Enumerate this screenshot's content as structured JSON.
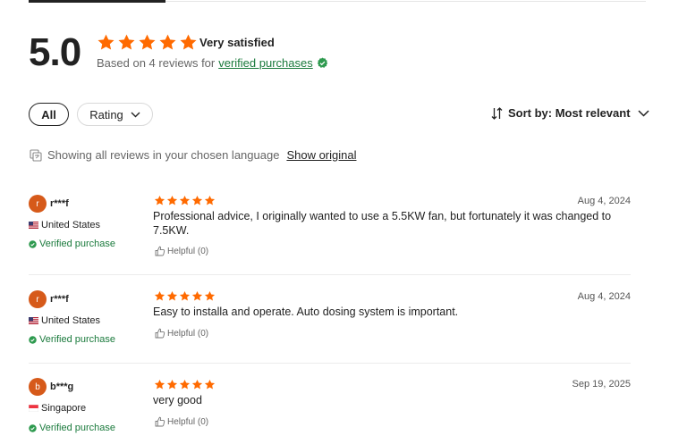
{
  "summary": {
    "rating": "5.0",
    "stars": 5,
    "satisfaction": "Very satisfied",
    "based_on": "Based on 4 reviews for",
    "verified_link": "verified purchases"
  },
  "filters": {
    "all_label": "All",
    "rating_label": "Rating",
    "sort_label": "Sort by: Most relevant"
  },
  "language": {
    "notice": "Showing all reviews in your chosen language",
    "show_original": "Show original"
  },
  "reviews": [
    {
      "initial": "r",
      "user": "r***f",
      "country": "United States",
      "verified": "Verified purchase",
      "stars": 5,
      "date": "Aug 4, 2024",
      "text": "Professional advice, I originally wanted to use a 5.5KW fan, but fortunately it was changed to 7.5KW.",
      "helpful": "Helpful (0)"
    },
    {
      "initial": "r",
      "user": "r***f",
      "country": "United States",
      "verified": "Verified purchase",
      "stars": 5,
      "date": "Aug 4, 2024",
      "text": "Easy to installa and operate. Auto dosing system is important.",
      "helpful": "Helpful (0)"
    },
    {
      "initial": "b",
      "user": "b***g",
      "country": "Singapore",
      "verified": "Verified purchase",
      "stars": 5,
      "date": "Sep 19, 2025",
      "text": "very good",
      "helpful": "Helpful (0)"
    }
  ],
  "colors": {
    "star": "#ff6a00",
    "verified": "#1a7a3c",
    "avatar": "#d65a1a"
  },
  "icons": {
    "star": "star-icon",
    "verified_badge": "verified-badge-icon",
    "sort": "sort-arrows-icon",
    "chevron": "chevron-down-icon",
    "translate": "translate-icon",
    "thumbs_up": "thumbs-up-icon",
    "flag_us": "us-flag-icon",
    "flag_sg": "singapore-flag-icon"
  }
}
